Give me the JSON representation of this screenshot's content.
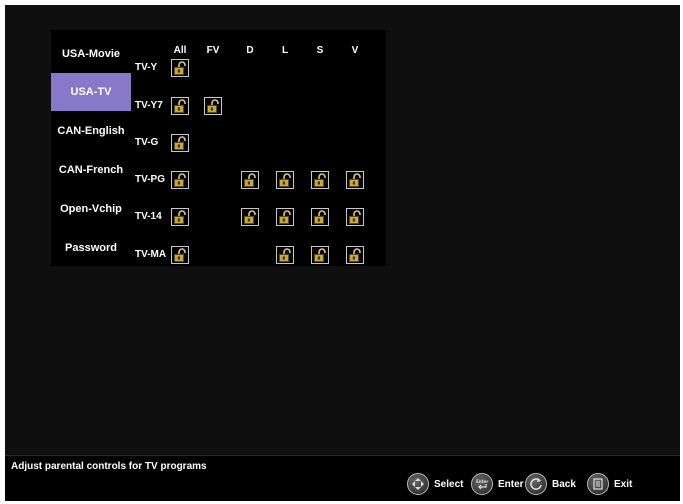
{
  "menu": {
    "items": [
      {
        "label": "USA-Movie",
        "selected": false
      },
      {
        "label": "USA-TV",
        "selected": true
      },
      {
        "label": "CAN-English",
        "selected": false
      },
      {
        "label": "CAN-French",
        "selected": false
      },
      {
        "label": "Open-Vchip",
        "selected": false
      },
      {
        "label": "Password",
        "selected": false
      }
    ],
    "selected_color": "#8878c8"
  },
  "grid": {
    "columns": [
      "All",
      "FV",
      "D",
      "L",
      "S",
      "V"
    ],
    "rows": [
      {
        "label": "TV-Y",
        "locks": [
          "All"
        ]
      },
      {
        "label": "TV-Y7",
        "locks": [
          "All",
          "FV"
        ]
      },
      {
        "label": "TV-G",
        "locks": [
          "All"
        ]
      },
      {
        "label": "TV-PG",
        "locks": [
          "All",
          "D",
          "L",
          "S",
          "V"
        ]
      },
      {
        "label": "TV-14",
        "locks": [
          "All",
          "D",
          "L",
          "S",
          "V"
        ]
      },
      {
        "label": "TV-MA",
        "locks": [
          "All",
          "L",
          "S",
          "V"
        ]
      }
    ],
    "lock_icon": "unlocked-padlock-icon"
  },
  "status": {
    "text": "Adjust parental controls for TV programs",
    "hints": [
      {
        "icon": "dpad-icon",
        "label": "Select"
      },
      {
        "icon": "enter-icon",
        "label": "Enter"
      },
      {
        "icon": "back-icon",
        "label": "Back"
      },
      {
        "icon": "exit-icon",
        "label": "Exit"
      }
    ]
  }
}
